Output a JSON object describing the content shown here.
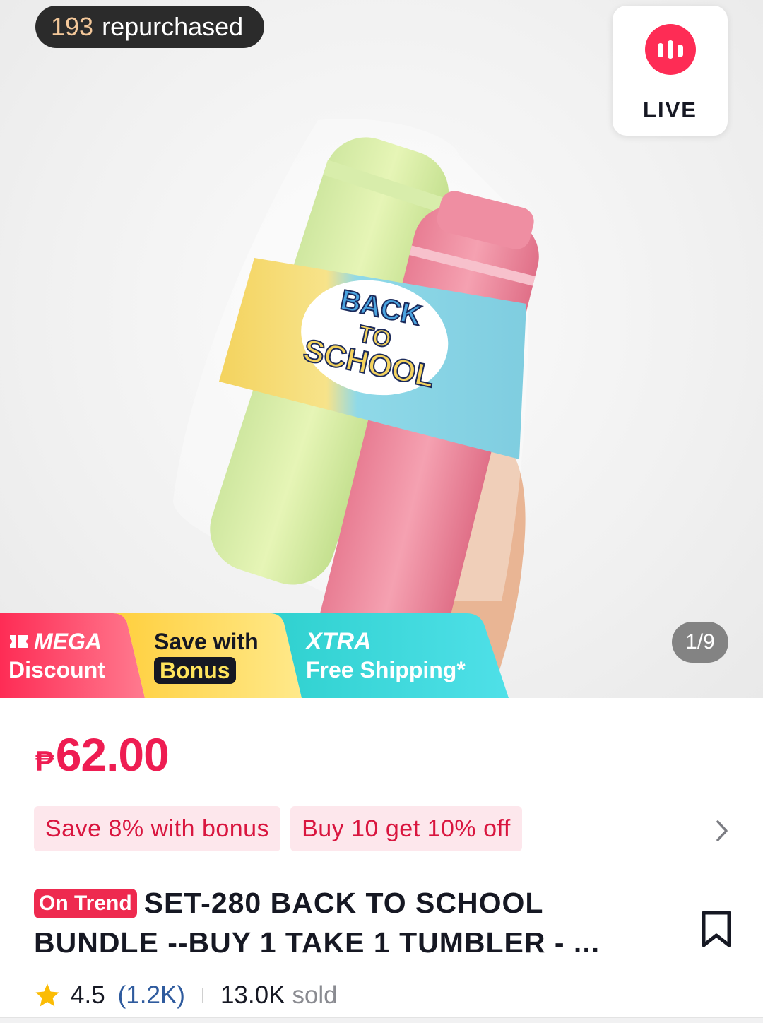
{
  "hero": {
    "repurchase_count": "193",
    "repurchase_label": "repurchased",
    "live_label": "LIVE",
    "image_counter": "1/9",
    "product_sleeve_text": [
      "BACK",
      "TO",
      "SCHOOL"
    ]
  },
  "promo": {
    "mega_line1": "MEGA",
    "mega_line2": "Discount",
    "save_line1": "Save with",
    "save_line2": "Bonus",
    "xtra_line1": "XTRA",
    "xtra_line2": "Free Shipping*"
  },
  "price": {
    "currency": "₱",
    "amount": "62.00"
  },
  "offers": [
    {
      "label": "Save 8% with bonus"
    },
    {
      "label": "Buy 10 get 10% off"
    }
  ],
  "product": {
    "badge": "On Trend",
    "title": "SET-280 BACK TO SCHOOL BUNDLE --BUY 1 TAKE 1 TUMBLER - ..."
  },
  "stats": {
    "rating": "4.5",
    "reviews": "(1.2K)",
    "sold_count": "13.0K",
    "sold_label": "sold"
  },
  "colors": {
    "accent": "#fe2c55",
    "price": "#ee1d52",
    "chip_bg": "#fde7ec",
    "review_link": "#2f5b9e"
  },
  "icons": [
    "live-bars-icon",
    "ticket-icon",
    "chevron-right-icon",
    "bookmark-icon",
    "star-icon"
  ]
}
